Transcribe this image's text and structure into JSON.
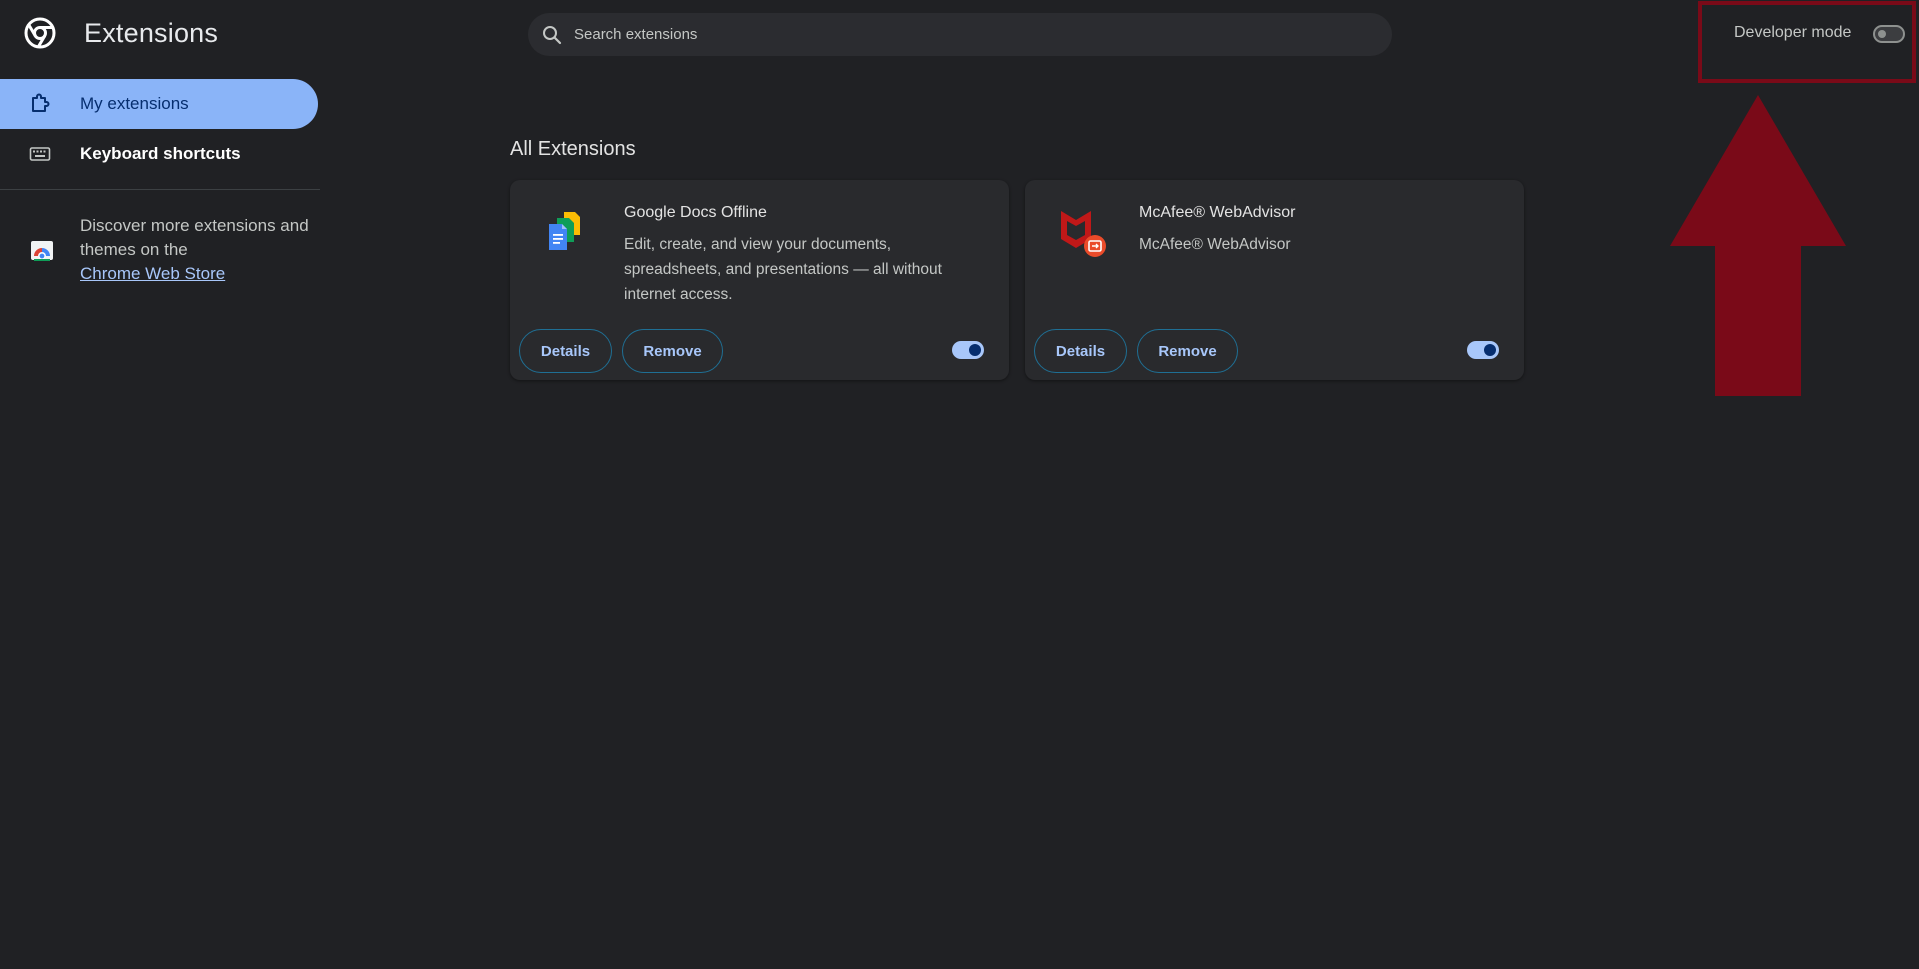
{
  "app": {
    "title": "Extensions",
    "logo": "chrome-logo"
  },
  "search": {
    "placeholder": "Search extensions",
    "value": "",
    "icon": "search-icon"
  },
  "developer_mode": {
    "label": "Developer mode",
    "enabled": false
  },
  "annotation": {
    "color": "#7a0a18",
    "shape": "up-arrow"
  },
  "sidebar": {
    "items": [
      {
        "label": "My extensions",
        "icon": "extension-puzzle-icon",
        "active": true
      },
      {
        "label": "Keyboard shortcuts",
        "icon": "keyboard-icon",
        "active": false
      }
    ],
    "promo": {
      "text": "Discover more extensions and themes on the",
      "link": "Chrome Web Store",
      "icon": "chrome-web-store-icon"
    }
  },
  "main": {
    "heading": "All Extensions",
    "extensions": [
      {
        "name": "Google Docs Offline",
        "description": "Edit, create, and view your documents, spreadsheets, and presentations — all without internet access.",
        "icon": "google-docs-offline-icon",
        "details_label": "Details",
        "remove_label": "Remove",
        "enabled": true
      },
      {
        "name": "McAfee® WebAdvisor",
        "description": "McAfee® WebAdvisor",
        "icon": "mcafee-webadvisor-icon",
        "details_label": "Details",
        "remove_label": "Remove",
        "enabled": true
      }
    ]
  },
  "colors": {
    "background": "#202124",
    "card": "#292a2d",
    "accent": "#8ab4f8",
    "link": "#a8c7fa"
  }
}
